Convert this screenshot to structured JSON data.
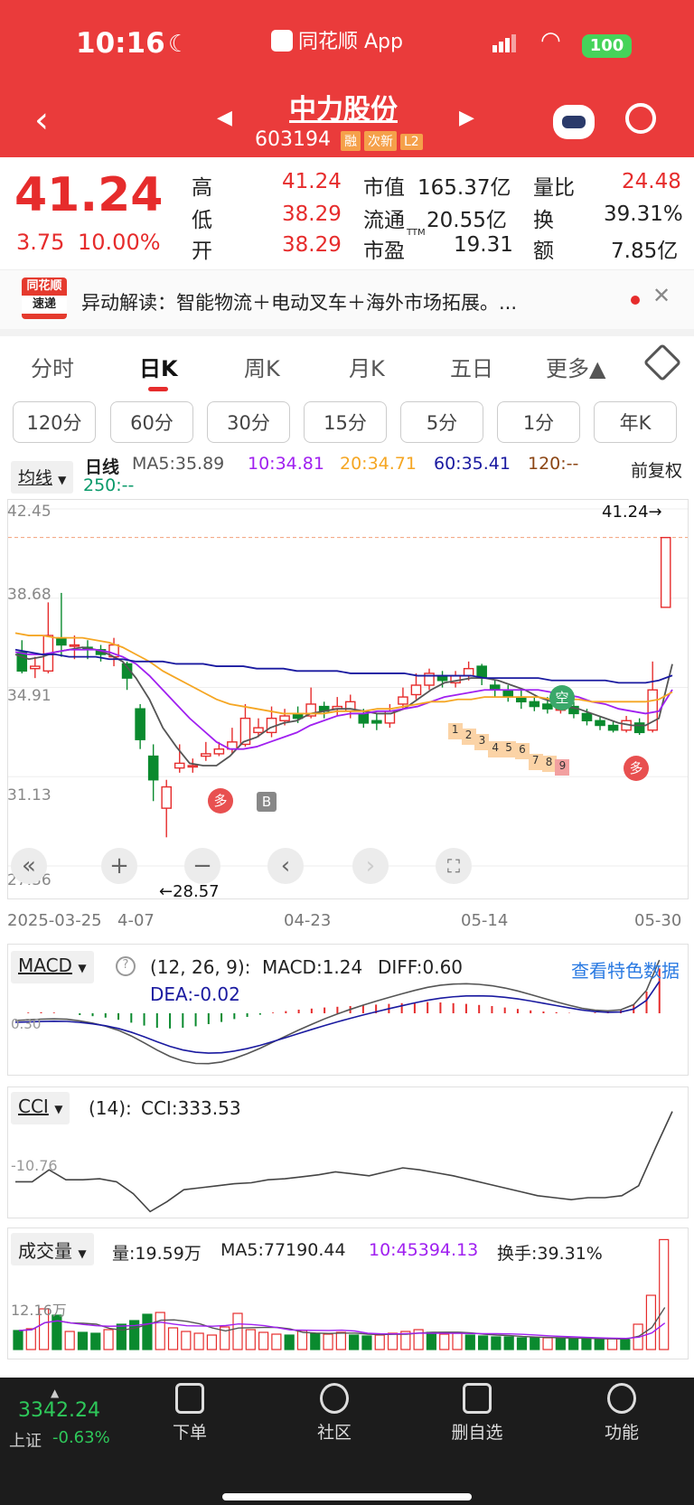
{
  "status": {
    "time": "10:16",
    "app": "同花顺 App",
    "battery": "100"
  },
  "header": {
    "name": "中力股份",
    "code": "603194",
    "tags": [
      "融",
      "次新",
      "L2"
    ]
  },
  "quote": {
    "price": "41.24",
    "change": "3.75",
    "pct": "10.00%",
    "rows": [
      [
        "高",
        "41.24",
        "市值",
        "165.37亿",
        "量比",
        "24.48"
      ],
      [
        "低",
        "38.29",
        "流通",
        "20.55亿",
        "换",
        "39.31%"
      ],
      [
        "开",
        "38.29",
        "市盈",
        "19.31",
        "额",
        "7.85亿"
      ]
    ],
    "ttm": "TTM"
  },
  "news": {
    "logo1": "同花顺",
    "logo2": "速递",
    "text": "异动解读：智能物流＋电动叉车＋海外市场拓展。..."
  },
  "tabs": [
    "分时",
    "日K",
    "周K",
    "月K",
    "五日",
    "更多▲"
  ],
  "periods": [
    "120分",
    "60分",
    "30分",
    "15分",
    "5分",
    "1分",
    "年K"
  ],
  "ma": {
    "sel": "均线",
    "line": "日线",
    "ma5": "MA5:35.89",
    "ma10": "10:34.81",
    "ma20": "20:34.71",
    "ma60": "60:35.41",
    "ma120": "120:--",
    "ma250": "250:--",
    "fq": "前复权"
  },
  "colors": {
    "up": "#e62c2c",
    "down": "#0a8a2e",
    "ma5": "#555555",
    "ma10": "#a020f0",
    "ma20": "#f5a623",
    "ma60": "#1a1aa0"
  },
  "price_axis": [
    "42.45",
    "38.68",
    "34.91",
    "31.13",
    "27.36"
  ],
  "marks": {
    "high": "41.24→",
    "low": "←28.57",
    "duo1": "多",
    "b": "B",
    "kong": "空",
    "duo2": "多",
    "seq": [
      "1",
      "2",
      "3",
      "4",
      "5",
      "6",
      "7",
      "8",
      "9"
    ]
  },
  "dates": [
    "2025-03-25",
    "4-07",
    "04-23",
    "05-14",
    "05-30"
  ],
  "macd": {
    "sel": "MACD",
    "params": "(12, 26, 9):",
    "macd": "MACD:1.24",
    "diff": "DIFF:0.60",
    "dea": "DEA:-0.02",
    "link": "查看特色数据",
    "axis": "0.30"
  },
  "cci": {
    "sel": "CCI",
    "params": "(14):",
    "val": "CCI:333.53",
    "axis": "-10.76"
  },
  "vol": {
    "sel": "成交量",
    "q": "量:19.59万",
    "ma5": "MA5:77190.44",
    "ma10": "10:45394.13",
    "turn": "换手:39.31%",
    "axis": "12.16万"
  },
  "footer": {
    "index": "3342.24",
    "name": "上证",
    "chg": "-0.63%",
    "items": [
      "下单",
      "社区",
      "删自选",
      "功能"
    ]
  },
  "chart_data": {
    "type": "candlestick",
    "ylim": [
      27.36,
      42.45
    ],
    "x_first": "2025-03-25",
    "x_last": "2025-05-30",
    "candles": [
      [
        36.4,
        35.6,
        36.9,
        35.5
      ],
      [
        35.7,
        35.8,
        36.2,
        35.3
      ],
      [
        35.6,
        37.1,
        38.5,
        35.5
      ],
      [
        37.0,
        36.7,
        38.9,
        36.2
      ],
      [
        36.7,
        36.7,
        37.1,
        36.1
      ],
      [
        36.6,
        36.5,
        36.9,
        36.1
      ],
      [
        36.5,
        36.3,
        36.7,
        36.0
      ],
      [
        36.2,
        36.7,
        37.0,
        35.8
      ],
      [
        35.9,
        35.3,
        36.0,
        34.8
      ],
      [
        34.0,
        32.7,
        34.2,
        32.3
      ],
      [
        32.0,
        31.0,
        32.5,
        30.1
      ],
      [
        29.8,
        30.7,
        31.0,
        28.57
      ],
      [
        31.5,
        31.7,
        32.5,
        31.3
      ],
      [
        31.6,
        31.6,
        31.9,
        31.3
      ],
      [
        32.0,
        32.1,
        32.6,
        31.8
      ],
      [
        32.1,
        32.3,
        32.6,
        32.0
      ],
      [
        32.3,
        32.6,
        33.2,
        32.1
      ],
      [
        32.5,
        33.6,
        34.2,
        32.4
      ],
      [
        33.0,
        33.2,
        33.6,
        32.8
      ],
      [
        33.0,
        33.6,
        34.1,
        32.8
      ],
      [
        33.5,
        33.7,
        34.0,
        33.3
      ],
      [
        33.8,
        33.6,
        34.1,
        33.4
      ],
      [
        33.7,
        34.2,
        34.9,
        33.6
      ],
      [
        34.1,
        33.9,
        34.3,
        33.6
      ],
      [
        34.0,
        34.1,
        34.5,
        33.7
      ],
      [
        33.9,
        34.3,
        34.6,
        33.6
      ],
      [
        33.8,
        33.4,
        34.0,
        33.2
      ],
      [
        33.5,
        33.4,
        33.8,
        33.1
      ],
      [
        33.4,
        33.9,
        34.2,
        33.2
      ],
      [
        34.2,
        34.5,
        34.9,
        34.0
      ],
      [
        34.6,
        35.0,
        35.5,
        34.4
      ],
      [
        35.0,
        35.5,
        35.7,
        34.8
      ],
      [
        35.4,
        35.2,
        35.6,
        34.9
      ],
      [
        35.1,
        35.4,
        35.6,
        34.9
      ],
      [
        35.4,
        35.7,
        36.0,
        35.2
      ],
      [
        35.8,
        35.3,
        35.9,
        35.0
      ],
      [
        35.0,
        34.8,
        35.2,
        34.5
      ],
      [
        34.8,
        34.5,
        35.0,
        34.3
      ],
      [
        34.5,
        34.3,
        34.8,
        34.0
      ],
      [
        34.3,
        34.1,
        34.5,
        33.9
      ],
      [
        34.2,
        34.0,
        34.5,
        33.8
      ],
      [
        34.0,
        34.0,
        34.3,
        33.8
      ],
      [
        34.1,
        33.8,
        34.3,
        33.6
      ],
      [
        33.8,
        33.5,
        34.0,
        33.3
      ],
      [
        33.5,
        33.3,
        33.7,
        33.1
      ],
      [
        33.3,
        33.1,
        33.5,
        33.0
      ],
      [
        33.1,
        33.5,
        33.7,
        33.0
      ],
      [
        33.4,
        33.0,
        33.6,
        32.9
      ],
      [
        33.1,
        34.8,
        36.0,
        33.0
      ],
      [
        38.29,
        41.24,
        41.24,
        38.29
      ]
    ],
    "ma5": [
      36.3,
      36.1,
      36.2,
      36.4,
      36.5,
      36.6,
      36.5,
      36.3,
      36.0,
      35.3,
      34.4,
      33.2,
      32.4,
      31.7,
      31.6,
      31.6,
      32.0,
      32.6,
      32.8,
      33.2,
      33.4,
      33.5,
      33.8,
      33.9,
      34.0,
      34.0,
      33.9,
      33.8,
      33.8,
      34.0,
      34.4,
      34.8,
      35.1,
      35.2,
      35.3,
      35.3,
      35.2,
      35.0,
      34.8,
      34.5,
      34.3,
      34.1,
      34.0,
      33.8,
      33.6,
      33.4,
      33.3,
      33.3,
      33.6,
      35.89
    ],
    "ma10": [
      36.4,
      36.3,
      36.3,
      36.4,
      36.5,
      36.5,
      36.5,
      36.4,
      36.2,
      35.9,
      35.4,
      34.8,
      34.2,
      33.6,
      33.1,
      32.6,
      32.3,
      32.3,
      32.4,
      32.6,
      32.8,
      33.0,
      33.3,
      33.5,
      33.7,
      33.8,
      33.8,
      33.9,
      33.9,
      34.0,
      34.1,
      34.3,
      34.5,
      34.6,
      34.7,
      34.8,
      34.8,
      34.8,
      34.8,
      34.8,
      34.7,
      34.6,
      34.5,
      34.3,
      34.2,
      34.0,
      33.9,
      33.8,
      33.9,
      34.81
    ],
    "ma20": [
      37.2,
      37.1,
      37.1,
      37.0,
      37.0,
      37.0,
      36.9,
      36.8,
      36.6,
      36.3,
      36.0,
      35.6,
      35.3,
      35.0,
      34.7,
      34.4,
      34.2,
      34.1,
      34.0,
      33.9,
      33.8,
      33.8,
      33.8,
      33.8,
      33.9,
      33.9,
      33.9,
      34.0,
      34.0,
      34.1,
      34.2,
      34.3,
      34.3,
      34.4,
      34.4,
      34.5,
      34.5,
      34.5,
      34.5,
      34.5,
      34.4,
      34.4,
      34.4,
      34.3,
      34.3,
      34.3,
      34.3,
      34.3,
      34.4,
      34.71
    ],
    "ma60": [
      36.5,
      36.4,
      36.3,
      36.3,
      36.2,
      36.2,
      36.2,
      36.1,
      36.1,
      36.0,
      36.0,
      36.0,
      35.9,
      35.9,
      35.9,
      35.8,
      35.8,
      35.8,
      35.7,
      35.7,
      35.7,
      35.6,
      35.6,
      35.6,
      35.6,
      35.5,
      35.5,
      35.5,
      35.5,
      35.5,
      35.4,
      35.4,
      35.4,
      35.4,
      35.4,
      35.3,
      35.3,
      35.3,
      35.3,
      35.3,
      35.2,
      35.2,
      35.2,
      35.2,
      35.2,
      35.1,
      35.1,
      35.1,
      35.2,
      35.41
    ],
    "volume": [
      2.1,
      2.3,
      4.5,
      3.8,
      2.0,
      1.9,
      1.8,
      2.2,
      2.8,
      3.2,
      3.9,
      4.1,
      2.4,
      2.0,
      1.8,
      1.6,
      2.5,
      4.0,
      2.2,
      1.9,
      1.7,
      1.6,
      2.1,
      1.8,
      1.7,
      1.9,
      1.6,
      1.5,
      1.6,
      1.8,
      2.0,
      2.2,
      1.9,
      1.7,
      1.8,
      1.6,
      1.5,
      1.4,
      1.4,
      1.3,
      1.3,
      1.3,
      1.2,
      1.2,
      1.2,
      1.1,
      1.2,
      1.1,
      2.8,
      6.0,
      12.16
    ],
    "macd_hist": [
      0,
      0.02,
      0.03,
      0.02,
      0,
      -0.05,
      -0.08,
      -0.12,
      -0.18,
      -0.26,
      -0.34,
      -0.4,
      -0.42,
      -0.4,
      -0.36,
      -0.3,
      -0.24,
      -0.16,
      -0.1,
      -0.04,
      0.02,
      0.06,
      0.1,
      0.13,
      0.16,
      0.18,
      0.2,
      0.22,
      0.24,
      0.26,
      0.28,
      0.3,
      0.31,
      0.3,
      0.28,
      0.26,
      0.23,
      0.2,
      0.16,
      0.12,
      0.08,
      0.05,
      0.03,
      0.01,
      0.0,
      0.02,
      0.05,
      0.1,
      0.25,
      0.6,
      1.24
    ],
    "cci": [
      -20,
      -20,
      40,
      -10,
      -10,
      -5,
      -20,
      -80,
      -170,
      -120,
      -60,
      -50,
      -40,
      -30,
      -25,
      -10,
      -5,
      5,
      15,
      30,
      20,
      10,
      30,
      50,
      40,
      25,
      10,
      -10,
      -30,
      -50,
      -70,
      -90,
      -100,
      -110,
      -100,
      -100,
      -90,
      -40,
      150,
      333.53
    ]
  }
}
